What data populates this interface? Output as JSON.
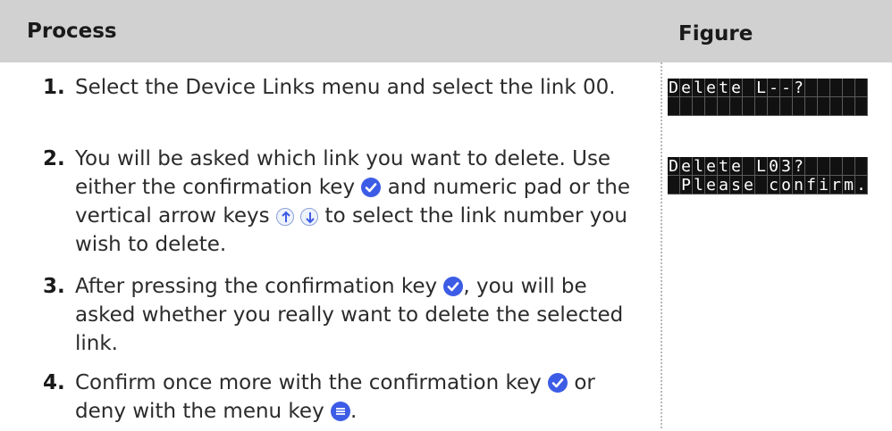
{
  "header": {
    "process": "Process",
    "figure": "Figure"
  },
  "steps": [
    {
      "num": "1.",
      "parts": [
        "Select the Device Links menu and select the link 00."
      ]
    },
    {
      "num": "2.",
      "parts": [
        "You will be asked which link you want to delete. Use either the confirmation key ",
        " and numeric pad or the vertical arrow keys ",
        " to select the link number you wish to delete."
      ]
    },
    {
      "num": "3.",
      "parts": [
        "After pressing the confirmation key ",
        ", you will be asked whether you really want to delete the selected link."
      ]
    },
    {
      "num": "4.",
      "parts": [
        "Confirm once more with the confirmation key ",
        " or deny with the menu key ",
        "."
      ]
    }
  ],
  "icons": {
    "check": "check-icon",
    "arrows": [
      "arrow-up-icon",
      "arrow-down-icon"
    ],
    "menu": "menu-icon"
  },
  "displays": [
    {
      "lines": [
        "Delete L--?",
        ""
      ]
    },
    {
      "lines": [
        "Delete L03?",
        " Please confirm."
      ]
    }
  ],
  "colors": {
    "header_bg": "#d1d1d1",
    "icon_blue": "#3d5ce6",
    "lcd_bg": "#111111",
    "lcd_text": "#ffffff"
  }
}
